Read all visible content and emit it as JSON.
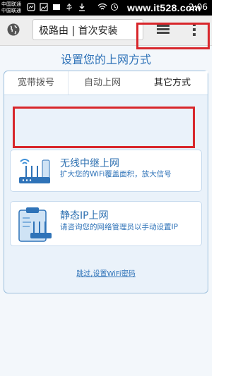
{
  "status_bar": {
    "carrier_1": "中国联通",
    "carrier_2": "中国联通",
    "watermark": "www.it528.com",
    "time": "2:06"
  },
  "browser": {
    "address_text": "极路由 | 首次安装",
    "icons": [
      "globe-icon",
      "tabs-icon",
      "menu-icon"
    ]
  },
  "page": {
    "heading": "设置您的上网方式",
    "tabs": [
      {
        "label": "宽带拨号"
      },
      {
        "label": "自动上网"
      },
      {
        "label": "其它方式"
      }
    ],
    "options": [
      {
        "title": "无线中继上网",
        "description": "扩大您的WiFi覆盖面积，放大信号"
      },
      {
        "title": "静态IP上网",
        "description": "请咨询您的网络管理员以手动设置IP"
      }
    ],
    "skip_link": "跳过,设置WiFi密码"
  },
  "colors": {
    "accent": "#2f73b8",
    "highlight": "#d8262b",
    "panel_bg": "#eaf2fa"
  }
}
